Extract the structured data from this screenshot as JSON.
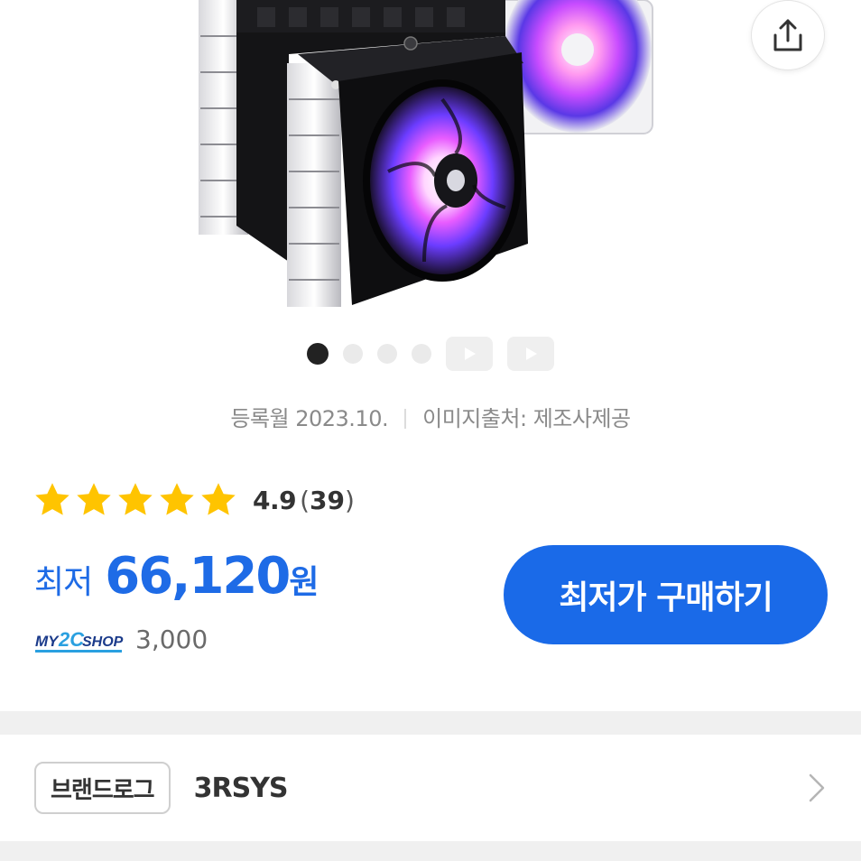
{
  "product": {
    "image_alt": "product-image"
  },
  "share": {
    "icon": "share-icon"
  },
  "carousel": {
    "total_images": 4,
    "active_index": 0,
    "video_count": 2
  },
  "meta": {
    "registered": "등록월 2023.10.",
    "image_source": "이미지출처: 제조사제공"
  },
  "rating": {
    "stars": 4.9,
    "score": "4.9",
    "count_open": "(",
    "count": "39",
    "count_close": ")"
  },
  "price": {
    "label": "최저",
    "value": "66,120",
    "unit": "원"
  },
  "buy_button": {
    "label": "최저가 구매하기"
  },
  "shop": {
    "logo_text": "MY2CSHOP",
    "price": "3,000"
  },
  "brand": {
    "tag": "브랜드로그",
    "name": "3RSYS"
  },
  "colors": {
    "accent": "#1a6ae8",
    "star": "#ffc400"
  }
}
